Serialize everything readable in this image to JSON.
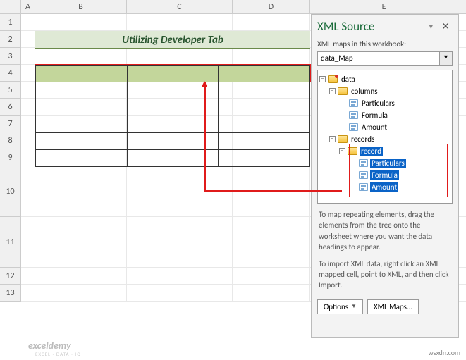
{
  "columns": {
    "A": "A",
    "B": "B",
    "C": "C",
    "D": "D",
    "E": "E"
  },
  "rows": [
    "1",
    "2",
    "3",
    "4",
    "5",
    "6",
    "7",
    "8",
    "9",
    "10",
    "11",
    "12",
    "13"
  ],
  "banner": {
    "title": "Utilizing Developer Tab"
  },
  "xml_panel": {
    "title": "XML Source",
    "maps_label": "XML maps in this workbook:",
    "selected_map": "data_Map",
    "tree": {
      "root": "data",
      "columns_node": "columns",
      "col_children": {
        "particulars": "Particulars",
        "formula": "Formula",
        "amount": "Amount"
      },
      "records_node": "records",
      "record_node": "record",
      "rec_children": {
        "particulars": "Particulars",
        "formula": "Formula",
        "amount": "Amount"
      }
    },
    "help1": "To map repeating elements, drag the elements from the tree onto the worksheet where you want the data headings to appear.",
    "help2": "To import XML data, right click an XML mapped cell, point to XML, and then click Import.",
    "options_btn": "Options",
    "xmlmaps_btn": "XML Maps..."
  },
  "watermark": {
    "brand": "exceldemy",
    "sub": "EXCEL · DATA · IQ"
  },
  "credit": "wsxdn.com",
  "col_widths": {
    "A": 20,
    "B": 130,
    "C": 150,
    "D": 110,
    "E": 210
  }
}
